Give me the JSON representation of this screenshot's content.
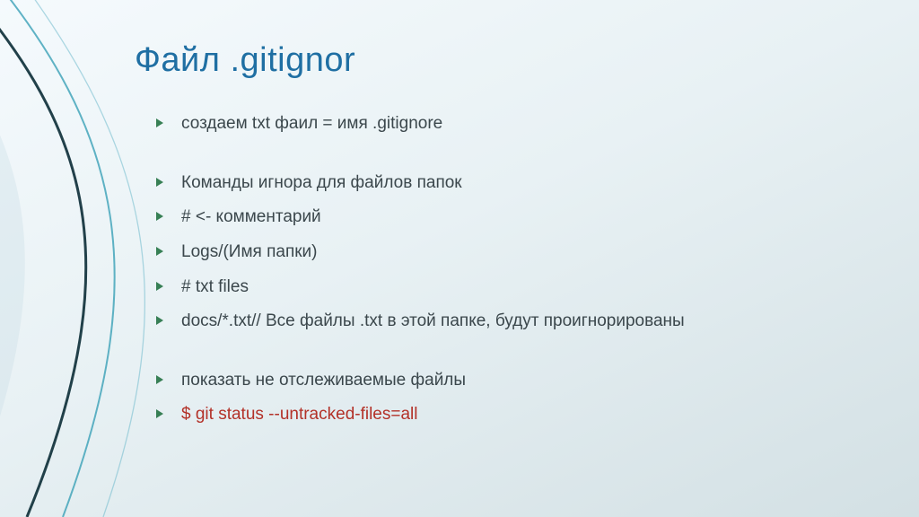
{
  "slide": {
    "title": "Файл .gitignor",
    "items": [
      {
        "text": "создаем txt фаил = имя .gitignore",
        "red": false
      },
      {
        "gap": true
      },
      {
        "text": "Команды игнора для файлов папок",
        "red": false
      },
      {
        "text": "# <- комментарий",
        "red": false
      },
      {
        "text": "Logs/(Имя папки)",
        "red": false
      },
      {
        "text": "# txt files",
        "red": false
      },
      {
        "text": "docs/*.txt// Все файлы .txt в этой папке, будут проигнорированы",
        "red": false
      },
      {
        "gap": true
      },
      {
        "text": "показать не отслеживаемые файлы",
        "red": false
      },
      {
        "text": "$ git status --untracked-files=all",
        "red": true
      }
    ]
  },
  "palette": {
    "title_color": "#1f6fa3",
    "body_color": "#3b474c",
    "accent_red": "#b33128",
    "bullet_green": "#176b38"
  }
}
